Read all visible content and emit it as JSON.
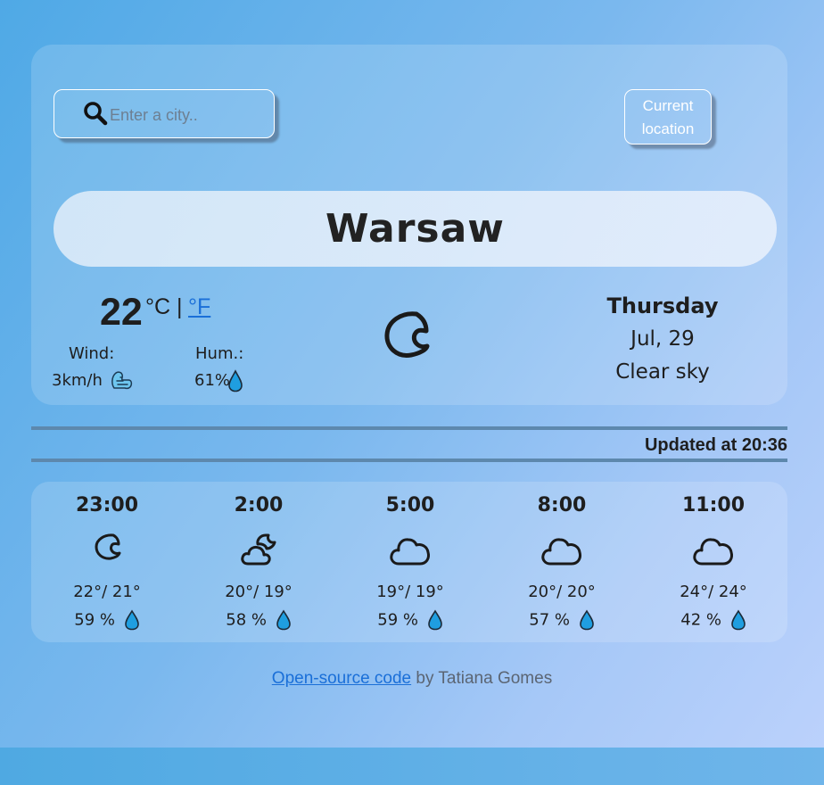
{
  "search": {
    "placeholder": "Enter a city.."
  },
  "current_location_button": {
    "label": "Current\nlocation"
  },
  "city": "Warsaw",
  "current": {
    "temperature": "22",
    "unit_celsius": "°C |",
    "unit_fahrenheit": "°F",
    "wind_label": "Wind:",
    "wind_value": "3km/h",
    "humidity_label": "Hum.:",
    "humidity_value": "61%",
    "weather_icon": "moon-icon",
    "day": "Thursday",
    "date": "Jul, 29",
    "description": "Clear sky"
  },
  "updated": "Updated at 20:36",
  "forecast": [
    {
      "time": "23:00",
      "icon": "moon-icon",
      "temps": "22°/ 21°",
      "humidity": "59 %"
    },
    {
      "time": "2:00",
      "icon": "cloud-moon-icon",
      "temps": "20°/ 19°",
      "humidity": "58 %"
    },
    {
      "time": "5:00",
      "icon": "cloud-icon",
      "temps": "19°/ 19°",
      "humidity": "59 %"
    },
    {
      "time": "8:00",
      "icon": "cloud-icon",
      "temps": "20°/ 20°",
      "humidity": "57 %"
    },
    {
      "time": "11:00",
      "icon": "cloud-icon",
      "temps": "24°/ 24°",
      "humidity": "42 %"
    }
  ],
  "footer": {
    "link_text": "Open-source code",
    "suffix": " by Tatiana Gomes"
  },
  "colors": {
    "accent_link": "#1a6fd8",
    "drop_icon": "#1f9ee0",
    "rule": "#5d88ad"
  }
}
